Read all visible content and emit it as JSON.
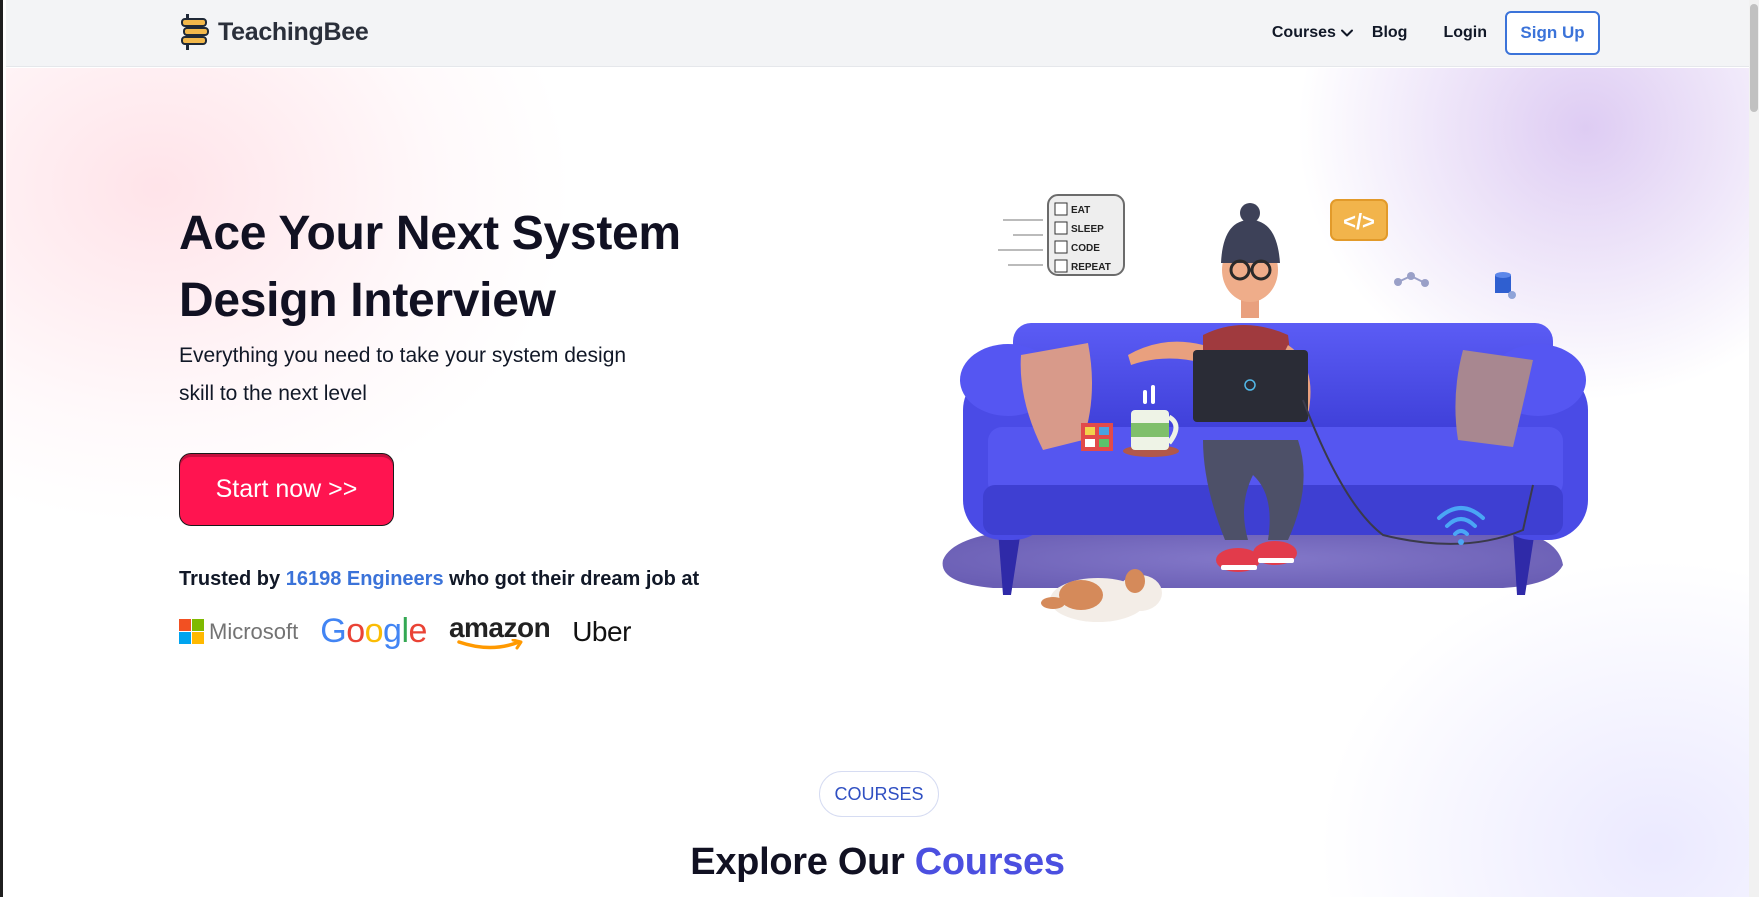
{
  "navbar": {
    "brand_name": "TeachingBee",
    "links": {
      "courses": "Courses",
      "blog": "Blog",
      "login": "Login"
    },
    "signup_label": "Sign Up"
  },
  "hero": {
    "title": "Ace Your Next System Design Interview",
    "subtitle": "Everything you need to take your system design skill to the next level",
    "cta_label": "Start now >>",
    "trusted_prefix": "Trusted by ",
    "trusted_count": "16198 Engineers",
    "trusted_suffix": " who got their dream job at",
    "companies": {
      "microsoft": "Microsoft",
      "google": "Google",
      "amazon": "amazon",
      "uber": "Uber"
    },
    "illustration": {
      "sign_items": [
        "EAT",
        "SLEEP",
        "CODE",
        "REPEAT"
      ],
      "code_badge": "</>"
    }
  },
  "courses_section": {
    "chip_label": "COURSES",
    "title_prefix": "Explore Our ",
    "title_accent": "Courses"
  },
  "colors": {
    "accent_blue": "#3b73d9",
    "cta_red": "#ff1450",
    "sofa_blue": "#4f4ff0",
    "title_accent": "#4b4fe0"
  }
}
